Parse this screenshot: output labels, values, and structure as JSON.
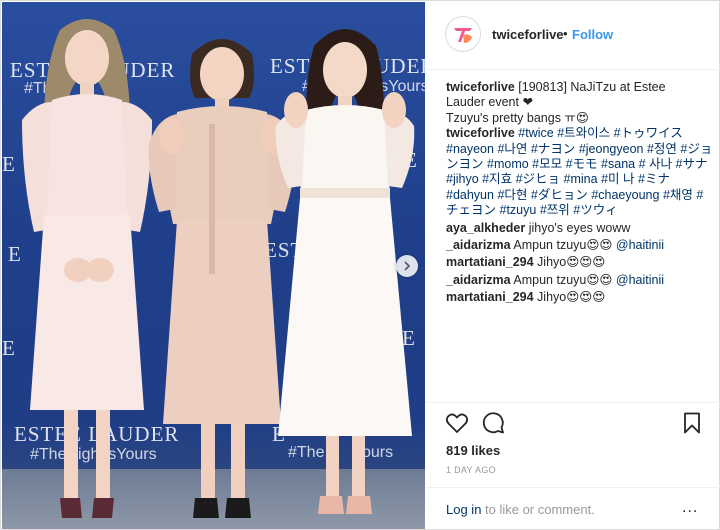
{
  "photo": {
    "backdrop": {
      "brand": "ESTEE LAUDER",
      "brand_short": "ESTE",
      "brand_cut": "E",
      "tagline": "#TheNightIsYours",
      "tag_short": "#The",
      "tag_cut": "ours"
    },
    "colors": {
      "backdrop": "#21418c",
      "floor": "#7d889c"
    }
  },
  "header": {
    "avatar_icon": "twice-logo-icon",
    "username": "twiceforlive",
    "separator": "•",
    "follow_label": "Follow"
  },
  "caption": {
    "username": "twiceforlive",
    "text_line1": "[190813] NaJiTzu at Estee",
    "text_line2": "Lauder event ❤",
    "text_line3": "Tzuyu's pretty bangs ㅠ😍"
  },
  "hashtag_comment": {
    "username": "twiceforlive",
    "tags": [
      "#twice",
      "#트와이스",
      "#トゥワイス",
      "#nayeon",
      "#나연",
      "#ナヨン",
      "#jeongyeon",
      "#정연",
      "#ジョンヨン",
      "#momo",
      "#모모",
      "#モモ",
      "#sana",
      "#",
      "사나",
      "#サナ",
      "#jihyo",
      "#지효",
      "#ジヒョ",
      "#mina",
      "#미",
      "나",
      "#ミナ",
      "#dahyun",
      "#다현",
      "#ダヒョン",
      "#chaeyoung",
      "#채영",
      "#チェヨン",
      "#tzuyu",
      "#쯔위",
      "#ツウィ"
    ]
  },
  "comments": [
    {
      "username": "aya_alkheder",
      "text": "jihyo's eyes woww",
      "mention": ""
    },
    {
      "username": "_aidarizma",
      "text": "Ampun tzuyu😍😍",
      "mention": "@haitinii"
    },
    {
      "username": "martatiani_294",
      "text": "Jihyo😍😍😍",
      "mention": ""
    },
    {
      "username": "_aidarizma",
      "text": "Ampun tzuyu😍😍",
      "mention": "@haitinii"
    },
    {
      "username": "martatiani_294",
      "text": "Jihyo😍😍😍",
      "mention": ""
    }
  ],
  "actions": {
    "like_icon": "heart-icon",
    "comment_icon": "comment-bubble-icon",
    "save_icon": "bookmark-icon",
    "likes_text": "819 likes",
    "time_text": "1 DAY AGO"
  },
  "login": {
    "link_label": "Log in",
    "rest_text": "to like or comment.",
    "more_label": "..."
  }
}
